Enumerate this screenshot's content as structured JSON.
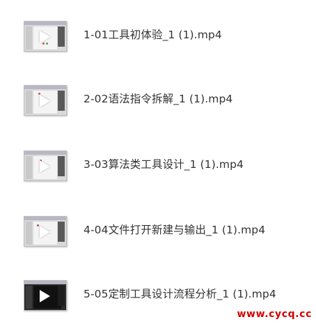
{
  "files": [
    {
      "name": "1-01工具初体验_1 (1).mp4",
      "thumbnail": "video-thumbnail",
      "theme": "light"
    },
    {
      "name": "2-02语法指令拆解_1 (1).mp4",
      "thumbnail": "video-thumbnail",
      "theme": "light"
    },
    {
      "name": "3-03算法类工具设计_1 (1).mp4",
      "thumbnail": "video-thumbnail",
      "theme": "light"
    },
    {
      "name": "4-04文件打开新建与输出_1 (1).mp4",
      "thumbnail": "video-thumbnail",
      "theme": "light"
    },
    {
      "name": "5-05定制工具设计流程分析_1 (1).mp4",
      "thumbnail": "video-thumbnail",
      "theme": "dark"
    }
  ],
  "watermark": "www.cycq.cc",
  "colors": {
    "text": "#333333",
    "watermark": "#d40000",
    "background": "#ffffff"
  }
}
